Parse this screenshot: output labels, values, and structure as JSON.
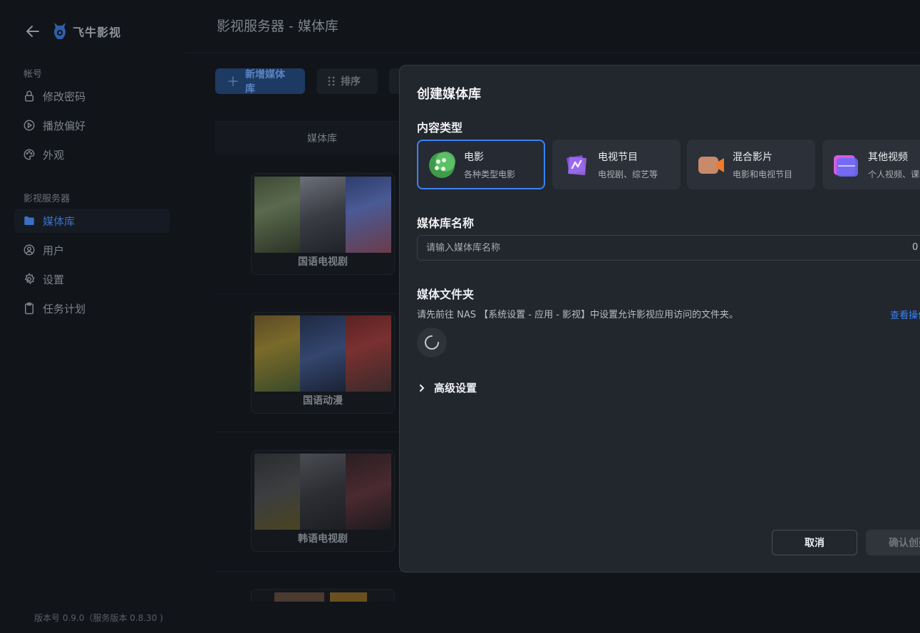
{
  "sidebar": {
    "brand": "飞牛影视",
    "account_section": "帐号",
    "account_items": [
      {
        "label": "修改密码",
        "icon": "lock-icon"
      },
      {
        "label": "播放偏好",
        "icon": "play-circle-icon"
      },
      {
        "label": "外观",
        "icon": "palette-icon"
      }
    ],
    "server_section": "影视服务器",
    "server_items": [
      {
        "label": "媒体库",
        "icon": "folder-icon",
        "active": true
      },
      {
        "label": "用户",
        "icon": "user-icon"
      },
      {
        "label": "设置",
        "icon": "gear-icon"
      },
      {
        "label": "任务计划",
        "icon": "clipboard-icon"
      }
    ],
    "version": "版本号 0.9.0（服务版本 0.8.30 )"
  },
  "main": {
    "title": "影视服务器 - 媒体库",
    "add_label": "新增媒体库",
    "sort_label": "排序",
    "column_header": "媒体库",
    "libraries": [
      {
        "name": "国语电视剧"
      },
      {
        "name": "国语动漫"
      },
      {
        "name": "韩语电视剧"
      }
    ]
  },
  "modal": {
    "title": "创建媒体库",
    "content_type_label": "内容类型",
    "types": [
      {
        "name": "电影",
        "desc": "各种类型电影",
        "selected": true
      },
      {
        "name": "电视节目",
        "desc": "电视剧、综艺等"
      },
      {
        "name": "混合影片",
        "desc": "电影和电视节目"
      },
      {
        "name": "其他视频",
        "desc": "个人视频、课程"
      }
    ],
    "name_label": "媒体库名称",
    "name_placeholder": "请输入媒体库名称",
    "name_counter": "0",
    "folder_label": "媒体文件夹",
    "folder_hint": "请先前往 NAS 【系统设置 - 应用 - 影视】中设置允许影视应用访问的文件夹。",
    "folder_link": "查看操作",
    "advanced_label": "高级设置",
    "cancel_label": "取消",
    "confirm_label": "确认创建"
  },
  "colors": {
    "accent": "#3b82f6",
    "modal_bg": "#22262d",
    "page_bg": "#111419"
  }
}
